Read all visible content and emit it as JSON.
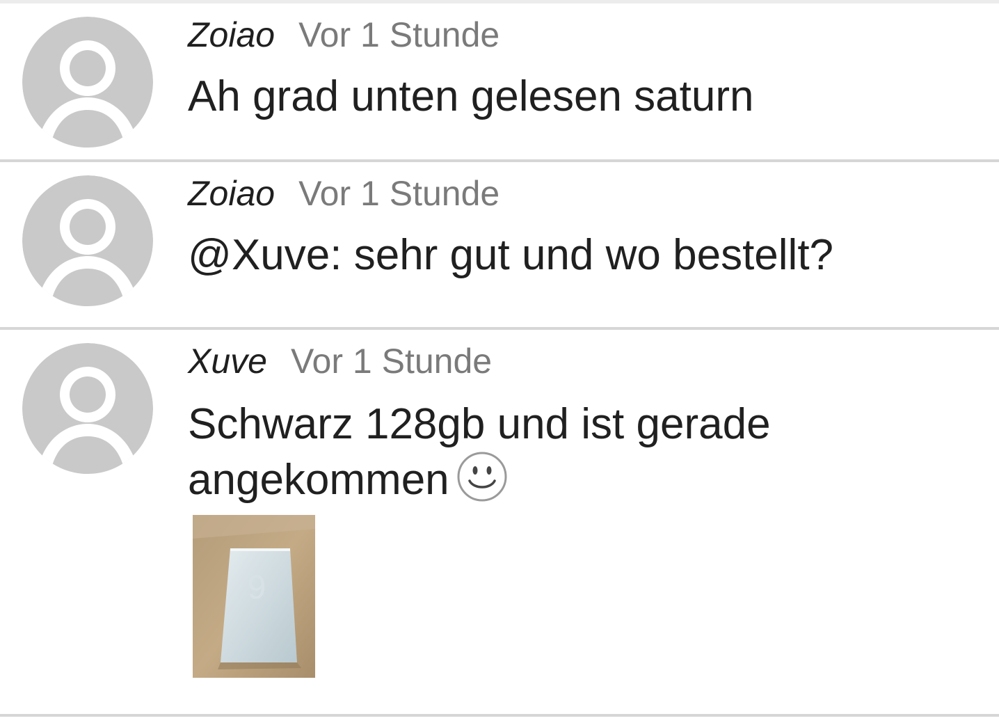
{
  "comments": [
    {
      "author": "Zoiao",
      "time": "Vor 1 Stunde",
      "text": "Ah grad unten gelesen saturn",
      "avatar_icon": "default-user-avatar-icon"
    },
    {
      "author": "Zoiao",
      "time": "Vor 1 Stunde",
      "text": "@Xuve: sehr gut und wo bestellt?",
      "avatar_icon": "default-user-avatar-icon"
    },
    {
      "author": "Xuve",
      "time": "Vor 1 Stunde",
      "text": "Schwarz 128gb und ist gerade\nangekommen",
      "emoji": "smiley-icon",
      "avatar_icon": "default-user-avatar-icon",
      "attachment": "phone-box-photo"
    }
  ],
  "colors": {
    "avatar": "#c9c9c9",
    "divider": "#d6d6d6",
    "author": "#1f1f1f",
    "time": "#7a7a7a",
    "text": "#202020"
  }
}
